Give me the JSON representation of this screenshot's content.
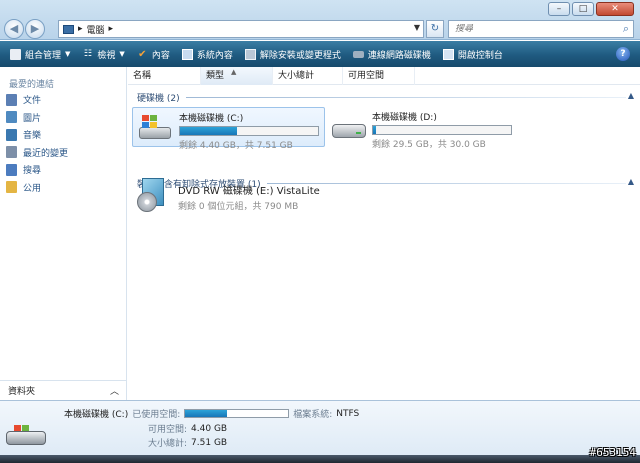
{
  "address": {
    "computer_icon": "computer-icon",
    "path": "電腦",
    "separator": "▸"
  },
  "search": {
    "placeholder": "搜尋"
  },
  "toolbar": {
    "organize": "組合管理",
    "views": "檢視",
    "properties": "內容",
    "system_properties": "系統內容",
    "uninstall": "解除安裝或變更程式",
    "map_drive": "連線網路磁碟機",
    "control_panel": "開啟控制台"
  },
  "left": {
    "favorites_title": "最愛的連結",
    "items": [
      {
        "label": "文件",
        "icon": "documents-icon",
        "color": "#5b7fb4"
      },
      {
        "label": "圖片",
        "icon": "pictures-icon",
        "color": "#4f8ac0"
      },
      {
        "label": "音樂",
        "icon": "music-icon",
        "color": "#3a78b0"
      },
      {
        "label": "最近的變更",
        "icon": "recent-changes-icon",
        "color": "#7d8fa8"
      },
      {
        "label": "搜尋",
        "icon": "search-folder-icon",
        "color": "#4c7cbf"
      },
      {
        "label": "公用",
        "icon": "public-folder-icon",
        "color": "#e4b543"
      }
    ],
    "folders_label": "資料夾"
  },
  "columns": {
    "name": "名稱",
    "type": "類型",
    "total": "大小總計",
    "free": "可用空間"
  },
  "groups": {
    "hdd": "硬碟機 (2)",
    "removable": "裝置中含有卸除式存放裝置 (1)"
  },
  "drives": {
    "c": {
      "name": "本機磁碟機 (C:)",
      "meta": "剩餘 4.40 GB，共 7.51 GB",
      "used_fraction": 0.41
    },
    "d": {
      "name": "本機磁碟機 (D:)",
      "meta": "剩餘 29.5 GB，共 30.0 GB",
      "used_fraction": 0.02
    },
    "e": {
      "name": "DVD RW 磁碟機 (E:) VistaLite",
      "meta": "剩餘 0 個位元組，共 790 MB"
    }
  },
  "details": {
    "drive_name": "本機磁碟機 (C:)",
    "used_label": "已使用空間:",
    "fs_label": "檔案系統:",
    "fs_value": "NTFS",
    "free_label": "可用空間:",
    "free_value": "4.40 GB",
    "total_label": "大小總計:",
    "total_value": "7.51 GB",
    "used_fraction": 0.41
  },
  "watermark": "#653154",
  "colors": {
    "toolbar": "#1f5a80",
    "bar_fill": "#1e8ccc",
    "link": "#2b5788"
  }
}
